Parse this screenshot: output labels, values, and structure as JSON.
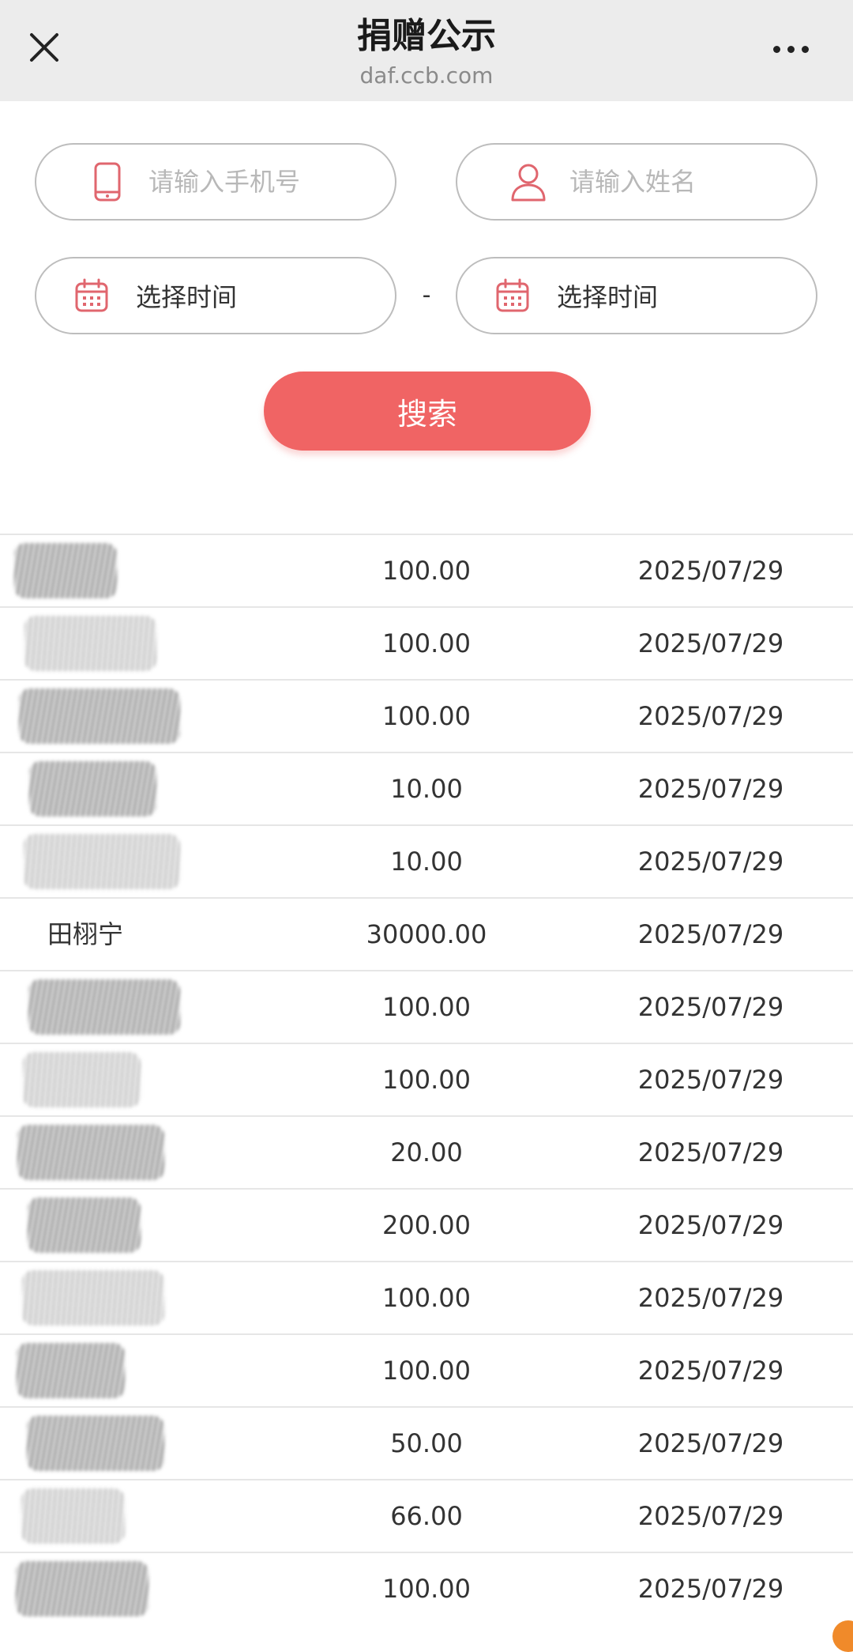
{
  "header": {
    "title": "捐赠公示",
    "domain": "daf.ccb.com",
    "close_icon": "close-icon",
    "more_icon": "more-horizontal-icon"
  },
  "search": {
    "phone_placeholder": "请输入手机号",
    "name_placeholder": "请输入姓名",
    "start_date": "选择时间",
    "end_date": "选择时间",
    "range_separator": "-",
    "button_label": "搜索",
    "accent_color": "#f06464"
  },
  "donations": [
    {
      "name": "",
      "amount": "100.00",
      "date": "2025/07/29",
      "redacted": true
    },
    {
      "name": "",
      "amount": "100.00",
      "date": "2025/07/29",
      "redacted": true
    },
    {
      "name": "",
      "amount": "100.00",
      "date": "2025/07/29",
      "redacted": true
    },
    {
      "name": "",
      "amount": "10.00",
      "date": "2025/07/29",
      "redacted": true
    },
    {
      "name": "",
      "amount": "10.00",
      "date": "2025/07/29",
      "redacted": true
    },
    {
      "name": "田栩宁",
      "amount": "30000.00",
      "date": "2025/07/29",
      "redacted": false
    },
    {
      "name": "",
      "amount": "100.00",
      "date": "2025/07/29",
      "redacted": true
    },
    {
      "name": "",
      "amount": "100.00",
      "date": "2025/07/29",
      "redacted": true
    },
    {
      "name": "",
      "amount": "20.00",
      "date": "2025/07/29",
      "redacted": true
    },
    {
      "name": "",
      "amount": "200.00",
      "date": "2025/07/29",
      "redacted": true
    },
    {
      "name": "",
      "amount": "100.00",
      "date": "2025/07/29",
      "redacted": true
    },
    {
      "name": "",
      "amount": "100.00",
      "date": "2025/07/29",
      "redacted": true
    },
    {
      "name": "",
      "amount": "50.00",
      "date": "2025/07/29",
      "redacted": true
    },
    {
      "name": "",
      "amount": "66.00",
      "date": "2025/07/29",
      "redacted": true
    },
    {
      "name": "",
      "amount": "100.00",
      "date": "2025/07/29",
      "redacted": true
    }
  ]
}
